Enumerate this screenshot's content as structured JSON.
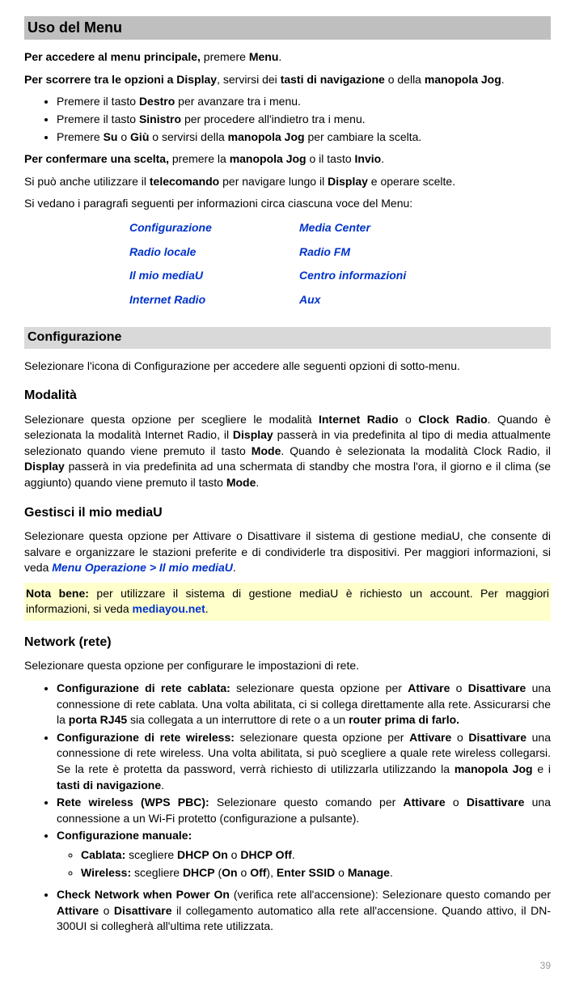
{
  "title": "Uso del Menu",
  "intro1a": "Per accedere al menu principale,",
  "intro1b": " premere ",
  "intro1c": "Menu",
  "intro1d": ".",
  "intro2a": "Per scorrere tra le opzioni a Display",
  "intro2b": ", servirsi dei ",
  "intro2c": "tasti di navigazione",
  "intro2d": " o della ",
  "intro2e": "manopola Jog",
  "intro2f": ".",
  "li1a": "Premere il tasto ",
  "li1b": "Destro",
  "li1c": " per avanzare tra i menu.",
  "li2a": "Premere il tasto ",
  "li2b": "Sinistro",
  "li2c": " per procedere all'indietro tra i menu.",
  "li3a": "Premere ",
  "li3b": "Su",
  "li3c": " o ",
  "li3d": "Giù",
  "li3e": " o servirsi della ",
  "li3f": "manopola Jog",
  "li3g": " per cambiare la scelta.",
  "confirm_a": "Per confermare una scelta,",
  "confirm_b": " premere la ",
  "confirm_c": "manopola Jog",
  "confirm_d": " o il tasto ",
  "confirm_e": "Invio",
  "confirm_f": ".",
  "remote_a": "Si può anche utilizzare il ",
  "remote_b": "telecomando",
  "remote_c": " per navigare lungo il ",
  "remote_d": "Display",
  "remote_e": " e operare scelte.",
  "info_para": "Si vedano i paragrafi seguenti per informazioni circa ciascuna voce del Menu:",
  "links": {
    "l1": "Configurazione",
    "r1": "Media Center",
    "l2": "Radio locale",
    "r2": "Radio FM",
    "l3": "Il mio mediaU",
    "r3": "Centro informazioni",
    "l4": "Internet Radio",
    "r4": "Aux"
  },
  "config_heading": "Configurazione",
  "config_intro": "Selezionare l'icona di Configurazione per accedere alle seguenti opzioni di sotto-menu.",
  "modalita_heading": "Modalità",
  "modalita_a": "Selezionare questa opzione per scegliere le modalità ",
  "modalita_b": "Internet Radio",
  "modalita_c": " o ",
  "modalita_d": "Clock Radio",
  "modalita_e": ". Quando è selezionata la modalità Internet Radio, il ",
  "modalita_f": "Display",
  "modalita_g": " passerà in via predefinita al tipo di media attualmente selezionato quando viene premuto il tasto ",
  "modalita_h": "Mode",
  "modalita_i": ". Quando è selezionata la modalità Clock Radio, il ",
  "modalita_j": "Display",
  "modalita_k": " passerà in via predefinita ad una schermata di standby che mostra l'ora, il giorno e il clima (se aggiunto) quando viene premuto il tasto ",
  "modalita_l": "Mode",
  "modalita_m": ".",
  "mediau_heading": "Gestisci il mio mediaU",
  "mediau_a": "Selezionare questa opzione per Attivare o Disattivare il sistema di gestione mediaU, che consente di salvare e organizzare le stazioni preferite e di condividerle tra dispositivi. Per maggiori informazioni, si veda ",
  "mediau_b": "Menu Operazione > Il mio mediaU",
  "mediau_c": ".",
  "note_a": "Nota bene:",
  "note_b": " per utilizzare il sistema di gestione mediaU è richiesto un account. Per maggiori informazioni, si veda ",
  "note_c": "mediayou.net",
  "note_d": ".",
  "network_heading": "Network (rete)",
  "network_intro": "Selezionare questa opzione per configurare le impostazioni di rete.",
  "n1_a": "Configurazione di rete cablata:",
  "n1_b": " selezionare questa opzione per ",
  "n1_c": "Attivare",
  "n1_d": " o ",
  "n1_e": "Disattivare",
  "n1_f": " una connessione di rete cablata. Una volta abilitata, ci si collega direttamente alla rete. Assicurarsi che la ",
  "n1_g": "porta RJ45",
  "n1_h": " sia collegata a un interruttore di rete o a un ",
  "n1_i": "router prima di farlo.",
  "n2_a": "Configurazione di rete wireless:",
  "n2_b": " selezionare questa opzione per ",
  "n2_c": "Attivare",
  "n2_d": " o ",
  "n2_e": "Disattivare",
  "n2_f": " una connessione di rete wireless. Una volta abilitata, si può scegliere a quale rete wireless collegarsi. Se la rete è protetta da password, verrà richiesto di utilizzarla utilizzando la ",
  "n2_g": "manopola Jog",
  "n2_h": " e i ",
  "n2_i": "tasti di navigazione",
  "n2_j": ".",
  "n3_a": "Rete wireless (WPS PBC):",
  "n3_b": " Selezionare questo comando per ",
  "n3_c": "Attivare",
  "n3_d": " o ",
  "n3_e": "Disattivare",
  "n3_f": " una connessione a un Wi-Fi protetto (configurazione a pulsante).",
  "n4_a": "Configurazione manuale:",
  "n4c_a": "Cablata:",
  "n4c_b": " scegliere ",
  "n4c_c": "DHCP On",
  "n4c_d": " o ",
  "n4c_e": "DHCP Off",
  "n4c_f": ".",
  "n4w_a": "Wireless:",
  "n4w_b": " scegliere ",
  "n4w_c": "DHCP",
  "n4w_d": " (",
  "n4w_e": "On",
  "n4w_f": " o ",
  "n4w_g": "Off",
  "n4w_h": "), ",
  "n4w_i": "Enter SSID",
  "n4w_j": " o ",
  "n4w_k": "Manage",
  "n4w_l": ".",
  "n5_a": "Check Network when Power On",
  "n5_b": " (verifica rete all'accensione): Selezionare questo comando per ",
  "n5_c": "Attivare",
  "n5_d": " o ",
  "n5_e": "Disattivare",
  "n5_f": " il collegamento automatico alla rete all'accensione. Quando attivo, il DN-300UI si collegherà all'ultima rete utilizzata.",
  "pagenum": "39"
}
